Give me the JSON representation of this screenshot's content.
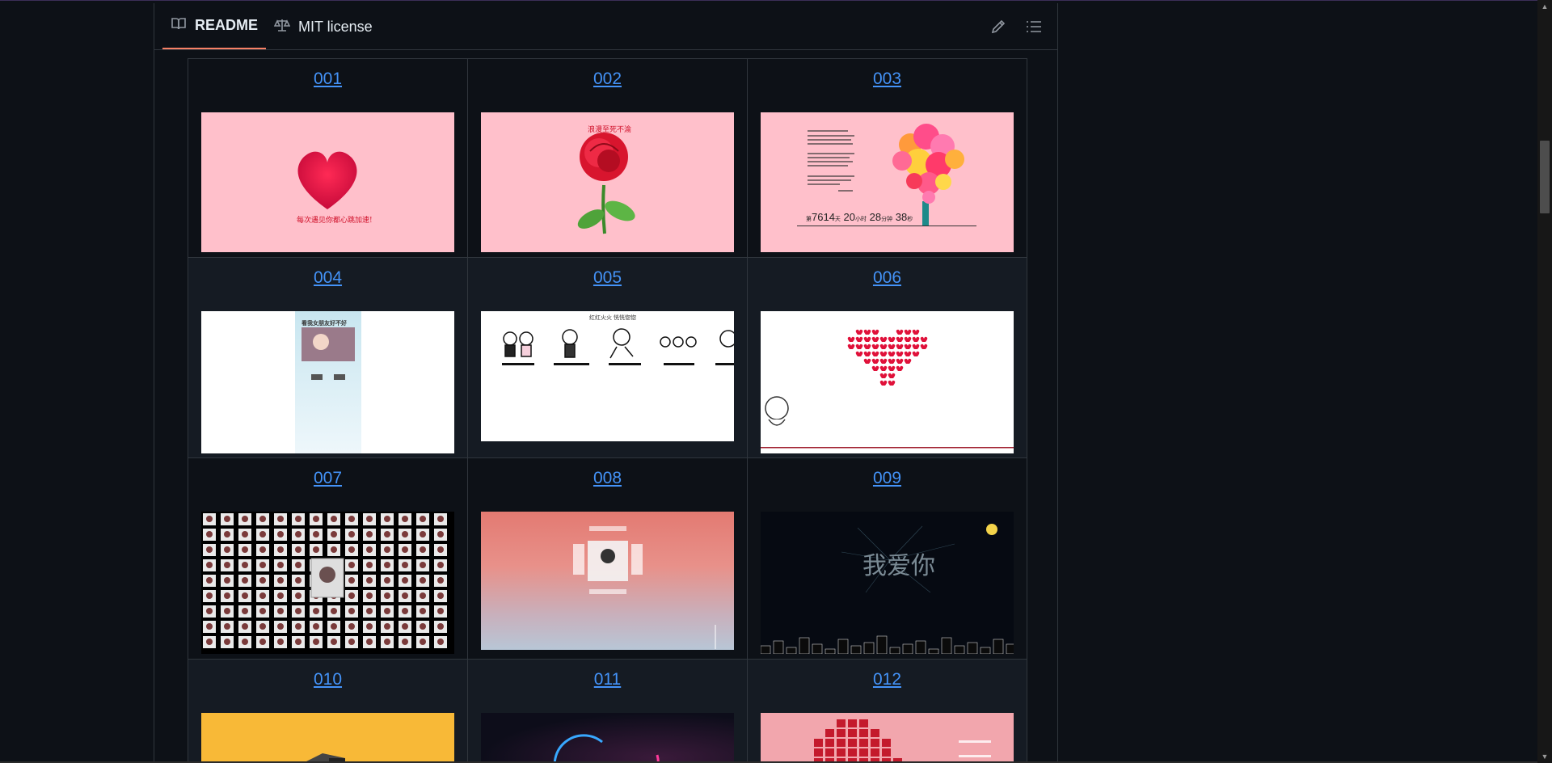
{
  "tabs": {
    "readme_label": "README",
    "license_label": "MIT license"
  },
  "toolbar": {
    "edit_icon": "pencil-icon",
    "outline_icon": "list-icon"
  },
  "gallery": {
    "items": [
      {
        "number": "001",
        "caption": "每次遇见你都心跳加速!"
      },
      {
        "number": "002",
        "caption": "浪漫至死不渝"
      },
      {
        "number": "003",
        "caption_counter_days": "7614",
        "caption_counter_hours": "20",
        "caption_counter_minutes": "28",
        "caption_counter_seconds": "38"
      },
      {
        "number": "004",
        "caption": "看我女朋友好不好"
      },
      {
        "number": "005",
        "caption": "红红火火 恍恍惚惚"
      },
      {
        "number": "006"
      },
      {
        "number": "007"
      },
      {
        "number": "008"
      },
      {
        "number": "009",
        "caption": "我爱你"
      },
      {
        "number": "010"
      },
      {
        "number": "011"
      },
      {
        "number": "012"
      }
    ]
  },
  "colors": {
    "link": "#4493f8",
    "tab_underline": "#f78166",
    "background": "#0d1117",
    "border": "#30363d"
  }
}
